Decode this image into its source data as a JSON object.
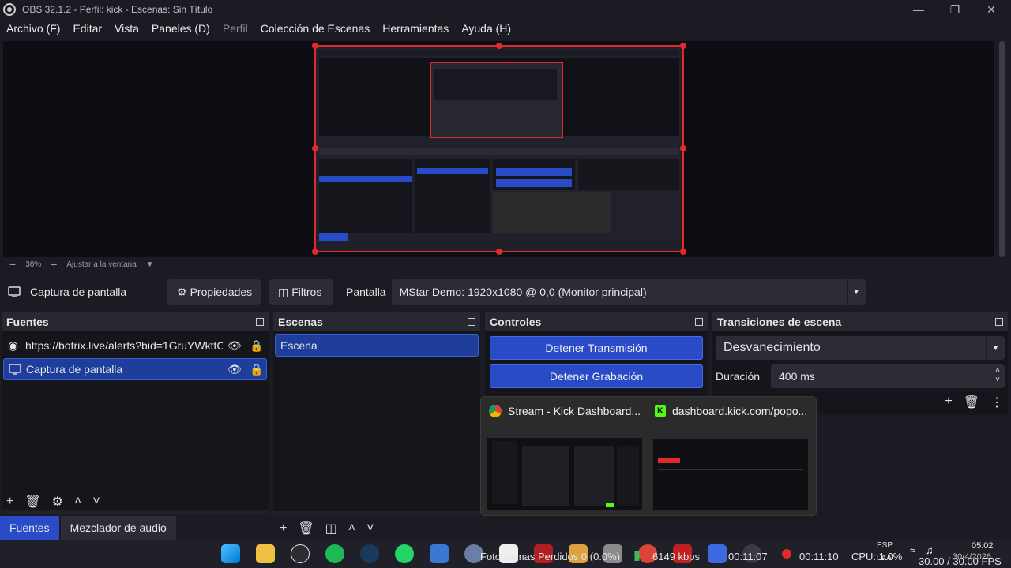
{
  "window": {
    "title": "OBS 32.1.2 - Perfil: kick - Escenas: Sin Título"
  },
  "menu": [
    "Archivo (F)",
    "Editar",
    "Vista",
    "Paneles (D)",
    "Perfil",
    "Colección de Escenas",
    "Herramientas",
    "Ayuda (H)"
  ],
  "zoom": {
    "minus": "−",
    "percent": "36%",
    "plus": "+",
    "fit": "Ajustar a la ventana"
  },
  "source_bar": {
    "name": "Captura de pantalla",
    "properties": "Propiedades",
    "filters": "Filtros",
    "display_label": "Pantalla",
    "display_value": "MStar Demo: 1920x1080 @ 0,0 (Monitor principal)"
  },
  "sources": {
    "title": "Fuentes",
    "items": [
      {
        "label": "https://botrix.live/alerts?bid=1GruYWkttC",
        "icon": "globe-icon",
        "selected": false
      },
      {
        "label": "Captura de pantalla",
        "icon": "monitor-icon",
        "selected": true
      }
    ]
  },
  "scenes": {
    "title": "Escenas",
    "items": [
      {
        "label": "Escena",
        "selected": true
      }
    ]
  },
  "controls": {
    "title": "Controles",
    "stop_stream": "Detener Transmisión",
    "stop_record": "Detener Grabación"
  },
  "transitions": {
    "title": "Transiciones de escena",
    "type": "Desvanecimiento",
    "duration_label": "Duración",
    "duration_value": "400 ms"
  },
  "bottom_tabs": {
    "sources": "Fuentes",
    "mixer": "Mezclador de audio"
  },
  "taskbar_popup": {
    "card1": "Stream - Kick Dashboard...",
    "card2": "dashboard.kick.com/popo..."
  },
  "status": {
    "dropped": "Fotogramas Perdidos 0 (0.0%)",
    "bitrate": "6149 kbps",
    "stream_time": "00:11:07",
    "rec_time": "00:11:10",
    "cpu": "CPU: 1.0%",
    "fps": "30.00 / 30.00 FPS",
    "lang_top": "ESP",
    "lang_bottom": "LAA",
    "time": "05:02",
    "date": "30/4/2026"
  },
  "colors": {
    "accent": "#2a4bc7",
    "selection_red": "#e12a2a",
    "background": "#1b1c23"
  }
}
